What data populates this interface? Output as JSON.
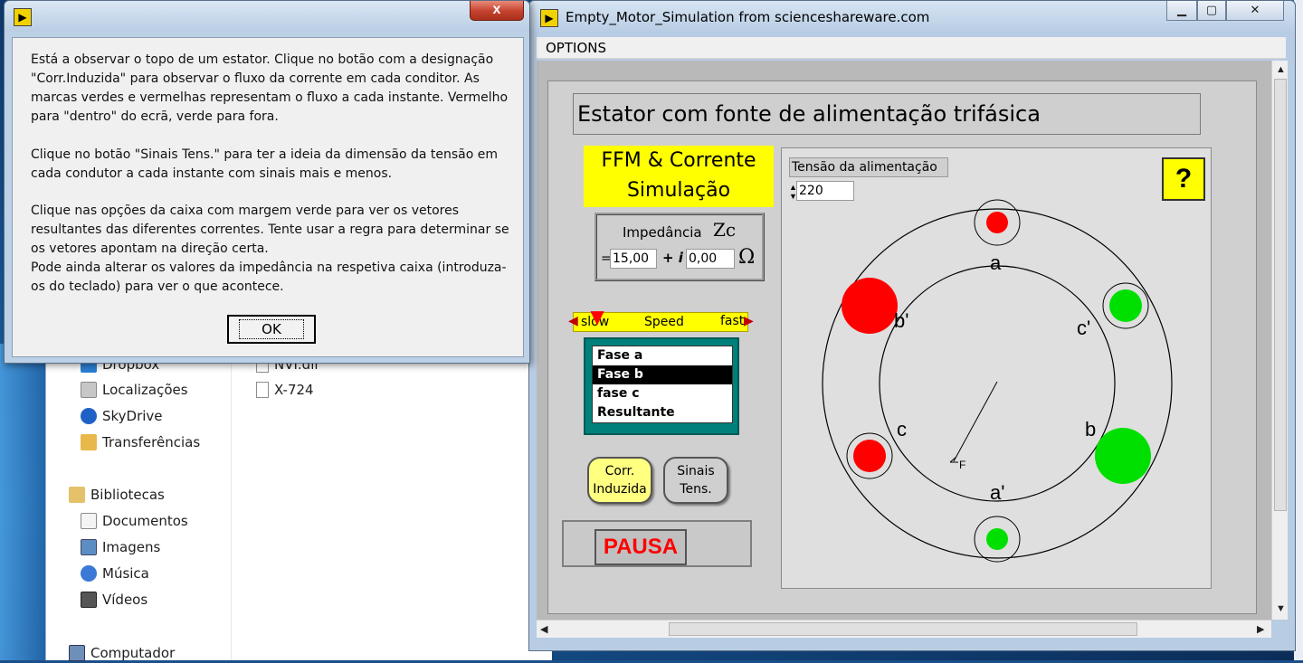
{
  "dialog": {
    "close_label": "x",
    "paragraphs": [
      "Está a observar o topo de um estator. Clique no botão com a designação \"Corr.Induzida\" para observar o fluxo da corrente em cada conditor. As marcas verdes e vermelhas representam o fluxo a cada instante. Vermelho para \"dentro\" do ecrã, verde para fora.",
      "Clique no botão \"Sinais Tens.\" para ter a ideia da dimensão da tensão em cada condutor a cada instante com sinais mais e menos.",
      "Clique nas opções da caixa com margem verde para ver os vetores resultantes das diferentes correntes. Tente usar a regra para determinar se os vetores apontam na direção certa.",
      "Pode ainda alterar os valores da impedância na respetiva caixa (introduza-os do teclado) para ver o que acontece."
    ],
    "ok_label": "OK"
  },
  "explorer": {
    "nav_items": [
      "Dropbox",
      "Localizações",
      "SkyDrive",
      "Transferências",
      "Bibliotecas",
      "Documentos",
      "Imagens",
      "Música",
      "Vídeos",
      "Computador"
    ],
    "files": [
      "NVI.dll",
      "X-724"
    ]
  },
  "main_window": {
    "title": "Empty_Motor_Simulation from scienceshareware.com",
    "menu": "OPTIONS",
    "heading": "Estator com fonte de alimentação trifásica",
    "ffm_line1": "FFM & Corrente",
    "ffm_line2": "Simulação",
    "impedance_label": "Impedância",
    "zc_label": "Zc",
    "eq_sign": "=",
    "plus_i": "+ i",
    "real_value": "15,00",
    "imag_value": "0,00",
    "ohm": "Ω",
    "speed": {
      "slow": "slow",
      "label": "Speed",
      "fast": "fast",
      "level": 0.08
    },
    "phase_options": [
      "Fase a",
      "Fase b",
      "fase c",
      "Resultante"
    ],
    "phase_selected": "Fase b",
    "corr_induzida_line1": "Corr.",
    "corr_induzida_line2": "Induzida",
    "sinais_tens_line1": "Sinais",
    "sinais_tens_line2": "Tens.",
    "pause_label": "PAUSA",
    "voltage_label": "Tensão  da  alimentação",
    "voltage_value": "220",
    "help_label": "?",
    "stator_labels": {
      "a": "a",
      "a_prime": "a'",
      "b": "b",
      "b_prime": "b'",
      "c": "c",
      "c_prime": "c'",
      "vector": "F"
    }
  },
  "colors": {
    "red": "#ff0000",
    "green": "#00e000",
    "yellow": "#ffff00",
    "teal": "#00807a"
  }
}
